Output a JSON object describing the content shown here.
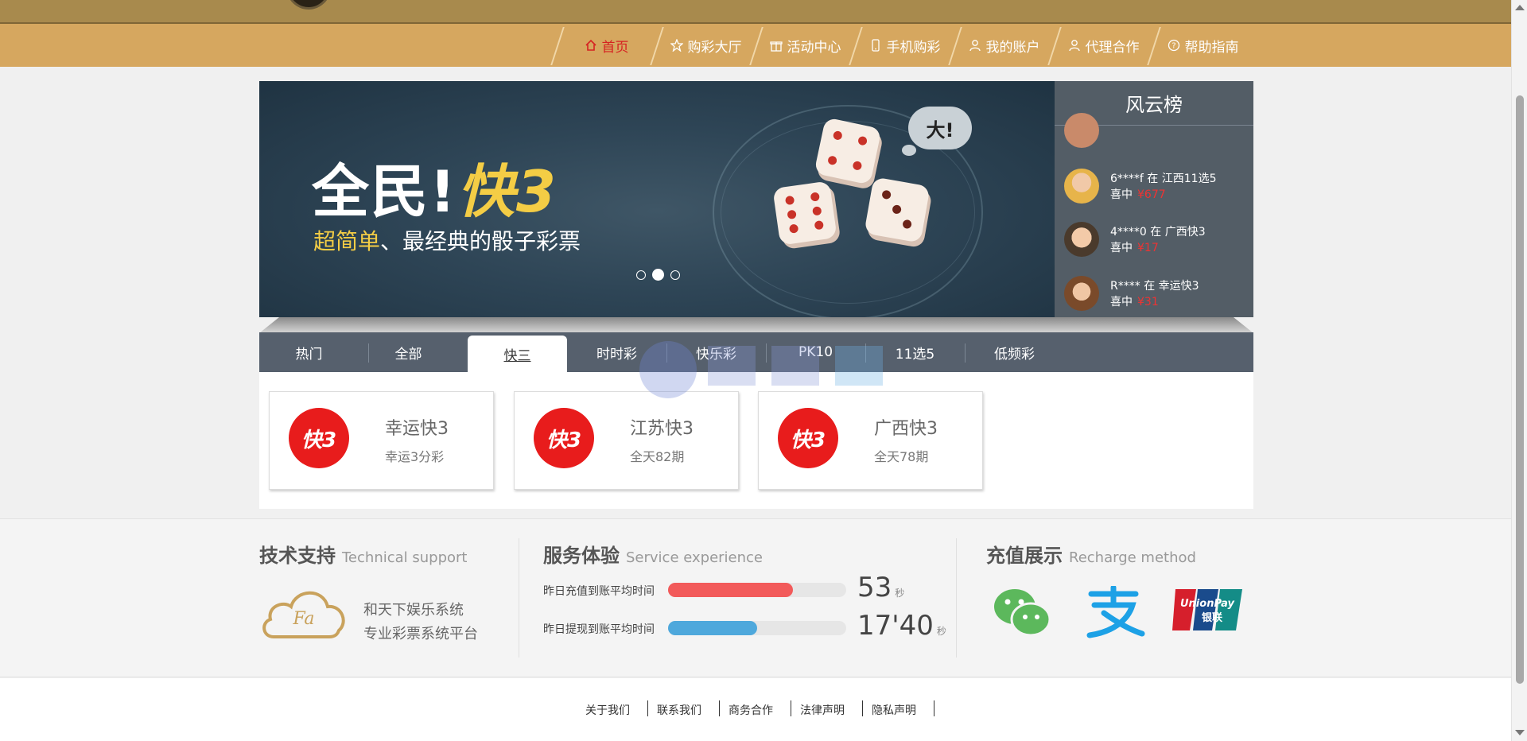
{
  "nav": {
    "items": [
      {
        "label": "首页",
        "icon": "home-icon",
        "active": true
      },
      {
        "label": "购彩大厅",
        "icon": "star-icon",
        "active": false
      },
      {
        "label": "活动中心",
        "icon": "gift-icon",
        "active": false
      },
      {
        "label": "手机购彩",
        "icon": "phone-icon",
        "active": false
      },
      {
        "label": "我的账户",
        "icon": "user-icon",
        "active": false
      },
      {
        "label": "代理合作",
        "icon": "agent-icon",
        "active": false
      },
      {
        "label": "帮助指南",
        "icon": "help-icon",
        "active": false
      }
    ]
  },
  "banner": {
    "title_main": "全民!",
    "title_highlight": "快3",
    "subtitle_highlight": "超简单",
    "subtitle_rest": "、最经典的骰子彩票",
    "bubble": "大!",
    "slide_count": 3,
    "active_slide": 2
  },
  "leaderboard": {
    "title": "风云榜",
    "entries": [
      {
        "user": "6****f",
        "prep": "在",
        "lottery": "江西11选5",
        "win_label": "喜中",
        "amount": "¥677"
      },
      {
        "user": "4****0",
        "prep": "在",
        "lottery": "广西快3",
        "win_label": "喜中",
        "amount": "¥17"
      },
      {
        "user": "R****",
        "prep": "在",
        "lottery": "幸运快3",
        "win_label": "喜中",
        "amount": "¥31"
      }
    ]
  },
  "tabs": [
    {
      "label": "热门",
      "active": false
    },
    {
      "label": "全部",
      "active": false
    },
    {
      "label": "快三",
      "active": true
    },
    {
      "label": "时时彩",
      "active": false
    },
    {
      "label": "快乐彩",
      "active": false
    },
    {
      "label": "PK10",
      "active": false
    },
    {
      "label": "11选5",
      "active": false
    },
    {
      "label": "低频彩",
      "active": false
    }
  ],
  "games": [
    {
      "name": "幸运快3",
      "desc": "幸运3分彩",
      "logo_text": "快3"
    },
    {
      "name": "江苏快3",
      "desc": "全天82期",
      "logo_text": "快3"
    },
    {
      "name": "广西快3",
      "desc": "全天78期",
      "logo_text": "快3"
    }
  ],
  "info": {
    "tech": {
      "title": "技术支持",
      "title_en": "Technical support",
      "logo_text": "Fa",
      "line1": "和天下娱乐系统",
      "line2": "专业彩票系统平台"
    },
    "service": {
      "title": "服务体验",
      "title_en": "Service experience",
      "stats": [
        {
          "label": "昨日充值到账平均时间",
          "value": "53",
          "unit": "秒",
          "fill": 0.7,
          "color": "#f25a5a"
        },
        {
          "label": "昨日提现到账平均时间",
          "value": "17'40",
          "unit": "秒",
          "fill": 0.5,
          "color": "#4ea8dc"
        }
      ]
    },
    "recharge": {
      "title": "充值展示",
      "title_en": "Recharge method",
      "methods": [
        {
          "name": "wechat-pay-icon"
        },
        {
          "name": "alipay-icon"
        },
        {
          "name": "unionpay-icon",
          "text1": "UnionPay",
          "text2": "银联"
        }
      ]
    }
  },
  "footer": {
    "links": [
      "关于我们",
      "联系我们",
      "商务合作",
      "法律声明",
      "隐私声明"
    ]
  },
  "colors": {
    "nav_bg": "#d6a75f",
    "accent_red": "#d62222",
    "tab_bg": "#56606d",
    "board_bg": "#535d66"
  }
}
